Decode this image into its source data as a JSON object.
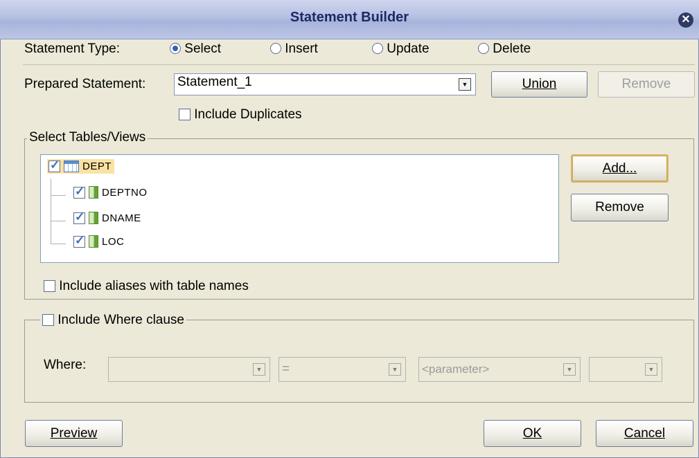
{
  "window": {
    "title": "Statement Builder"
  },
  "statement_type": {
    "label": "Statement Type:",
    "options": [
      {
        "label": "Select",
        "selected": true
      },
      {
        "label": "Insert",
        "selected": false
      },
      {
        "label": "Update",
        "selected": false
      },
      {
        "label": "Delete",
        "selected": false
      }
    ]
  },
  "prepared_statement": {
    "label": "Prepared Statement:",
    "value": "Statement_1",
    "union_label": "Union",
    "remove_label": "Remove",
    "include_duplicates_label": "Include Duplicates"
  },
  "tables": {
    "group_label": "Select Tables/Views",
    "tree": {
      "table": "DEPT",
      "columns": [
        "DEPTNO",
        "DNAME",
        "LOC"
      ]
    },
    "add_label": "Add...",
    "remove_label": "Remove",
    "include_aliases_label": "Include aliases with table names"
  },
  "where": {
    "include_label": "Include Where clause",
    "label": "Where:",
    "field_value": "",
    "operator_value": "=",
    "parameter_value": "<parameter>",
    "extra_value": ""
  },
  "footer": {
    "preview_label": "Preview",
    "ok_label": "OK",
    "cancel_label": "Cancel"
  }
}
